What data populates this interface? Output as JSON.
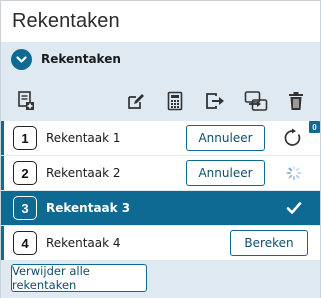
{
  "title": "Rekentaken",
  "accordion": {
    "title": "Rekentaken",
    "chevron_icon": "chevron-down-icon"
  },
  "toolbar": {
    "icons": [
      "add-document-icon",
      "edit-icon",
      "calculator-icon",
      "export-icon",
      "transfer-icon",
      "trash-icon"
    ]
  },
  "tasks": [
    {
      "number": "1",
      "name": "Rekentaak 1",
      "button": "Annuleer",
      "status": "refresh-icon",
      "badge": "0"
    },
    {
      "number": "2",
      "name": "Rekentaak 2",
      "button": "Annuleer",
      "status": "loading-spinner-icon"
    },
    {
      "number": "3",
      "name": "Rekentaak 3",
      "status": "checkmark-icon"
    },
    {
      "number": "4",
      "name": "Rekentaak 4",
      "button": "Bereken"
    }
  ],
  "footer": {
    "clear_all_label": "Verwijder alle rekentaken"
  },
  "colors": {
    "accent": "#0e6a93",
    "panel_bg": "#dfe9f1",
    "border": "#c9d3da"
  }
}
